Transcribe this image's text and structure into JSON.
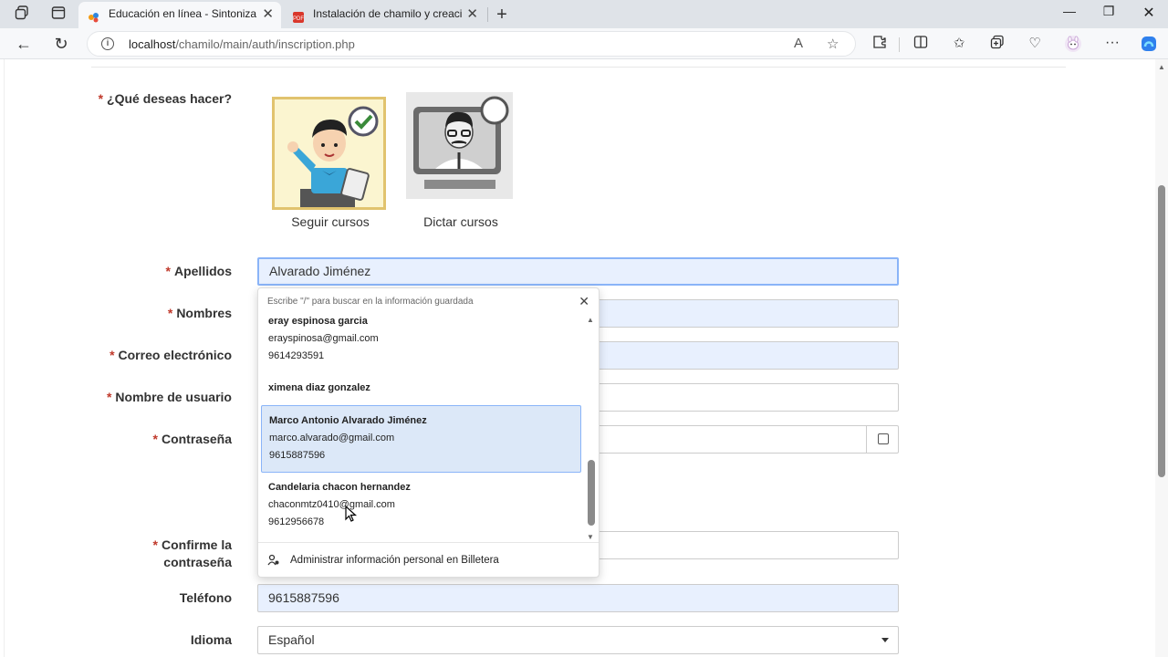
{
  "browser": {
    "tabs": [
      {
        "title": "Educación en línea - Sintoniza el",
        "active": true
      },
      {
        "title": "Instalación de chamilo y creación",
        "active": false
      }
    ],
    "new_tab_symbol": "+",
    "url_host": "localhost",
    "url_path": "/chamilo/main/auth/inscription.php"
  },
  "form": {
    "what_label": "¿Qué deseas hacer?",
    "required_mark": "*",
    "choices": [
      {
        "label": "Seguir cursos",
        "selected": true
      },
      {
        "label": "Dictar cursos",
        "selected": false
      }
    ],
    "apellidos_label": "Apellidos",
    "apellidos_value": "Alvarado Jiménez",
    "nombres_label": "Nombres",
    "correo_label": "Correo electrónico",
    "usuario_label": "Nombre de usuario",
    "contrasena_label": "Contraseña",
    "confirme_label_1": "Confirme la",
    "confirme_label_2": "contraseña",
    "telefono_label": "Teléfono",
    "telefono_value": "9615887596",
    "idioma_label": "Idioma",
    "idioma_value": "Español"
  },
  "autofill": {
    "hint": "Escribe \"/\" para buscar en la información guardada",
    "entries": [
      {
        "name": "eray espinosa garcia",
        "email": "erayspinosa@gmail.com",
        "phone": "9614293591"
      },
      {
        "name": "ximena diaz gonzalez"
      },
      {
        "name": "Marco Antonio Alvarado Jiménez",
        "email": "marco.alvarado@gmail.com",
        "phone": "9615887596"
      },
      {
        "name": "Candelaria chacon hernandez",
        "email": "chaconmtz0410@gmail.com",
        "phone": "9612956678"
      }
    ],
    "footer": "Administrar información personal en Billetera"
  },
  "colors": {
    "required": "#c0392b",
    "autofill_bg": "#e8f0fe",
    "focus": "#8ab4f8",
    "selected_choice_bg": "#fbf5d0"
  }
}
